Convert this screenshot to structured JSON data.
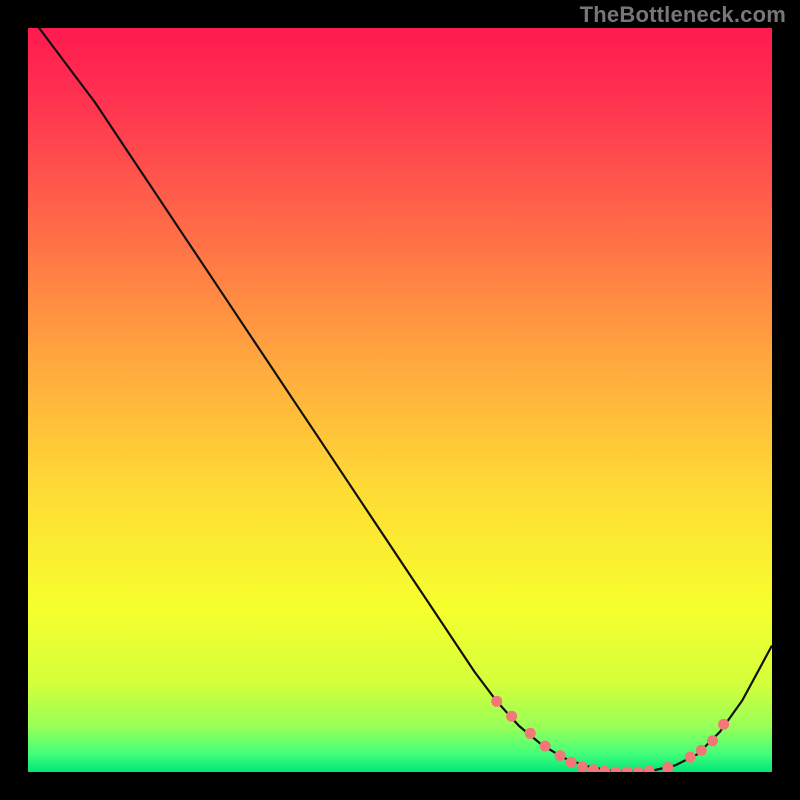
{
  "watermark": "TheBottleneck.com",
  "colors": {
    "dot": "#f27777",
    "curve": "#111111",
    "frame": "#000000"
  },
  "chart_data": {
    "type": "line",
    "title": "",
    "xlabel": "",
    "ylabel": "",
    "xlim": [
      0,
      100
    ],
    "ylim": [
      0,
      100
    ],
    "grid": false,
    "series": [
      {
        "name": "bottleneck-curve",
        "x": [
          0,
          3,
          6,
          9,
          12,
          15,
          18,
          21,
          24,
          27,
          30,
          33,
          36,
          39,
          42,
          45,
          48,
          51,
          54,
          57,
          60,
          63,
          66,
          69,
          72,
          75,
          78,
          81,
          84,
          87,
          90,
          93,
          96,
          100
        ],
        "y": [
          102,
          98,
          94,
          90,
          85.5,
          81,
          76.5,
          72,
          67.5,
          63,
          58.5,
          54,
          49.5,
          45,
          40.5,
          36,
          31.5,
          27,
          22.5,
          18,
          13.5,
          9.5,
          6.2,
          3.7,
          1.9,
          0.8,
          0.2,
          0,
          0.2,
          0.9,
          2.4,
          5.4,
          9.6,
          17
        ],
        "points_shown": [
          {
            "x": 63,
            "y": 9.5
          },
          {
            "x": 65,
            "y": 7.5
          },
          {
            "x": 67.5,
            "y": 5.2
          },
          {
            "x": 69.5,
            "y": 3.5
          },
          {
            "x": 71.5,
            "y": 2.2
          },
          {
            "x": 73,
            "y": 1.3
          },
          {
            "x": 74.5,
            "y": 0.7
          },
          {
            "x": 76,
            "y": 0.3
          },
          {
            "x": 77.5,
            "y": 0.1
          },
          {
            "x": 79,
            "y": 0
          },
          {
            "x": 80.5,
            "y": 0
          },
          {
            "x": 82,
            "y": 0
          },
          {
            "x": 83.5,
            "y": 0.1
          },
          {
            "x": 86,
            "y": 0.6
          },
          {
            "x": 89,
            "y": 2.0
          },
          {
            "x": 90.5,
            "y": 2.9
          },
          {
            "x": 92,
            "y": 4.2
          },
          {
            "x": 93.5,
            "y": 6.4
          }
        ]
      }
    ],
    "gradient_stops": [
      {
        "offset": 0,
        "color": "#ff1a4f"
      },
      {
        "offset": 0.1,
        "color": "#ff3350"
      },
      {
        "offset": 0.28,
        "color": "#ff6f47"
      },
      {
        "offset": 0.45,
        "color": "#ffa83e"
      },
      {
        "offset": 0.62,
        "color": "#ffdb35"
      },
      {
        "offset": 0.78,
        "color": "#f6ff2e"
      },
      {
        "offset": 0.88,
        "color": "#d4ff3a"
      },
      {
        "offset": 0.94,
        "color": "#97ff58"
      },
      {
        "offset": 0.975,
        "color": "#44ff7a"
      },
      {
        "offset": 1.0,
        "color": "#00e679"
      }
    ]
  }
}
